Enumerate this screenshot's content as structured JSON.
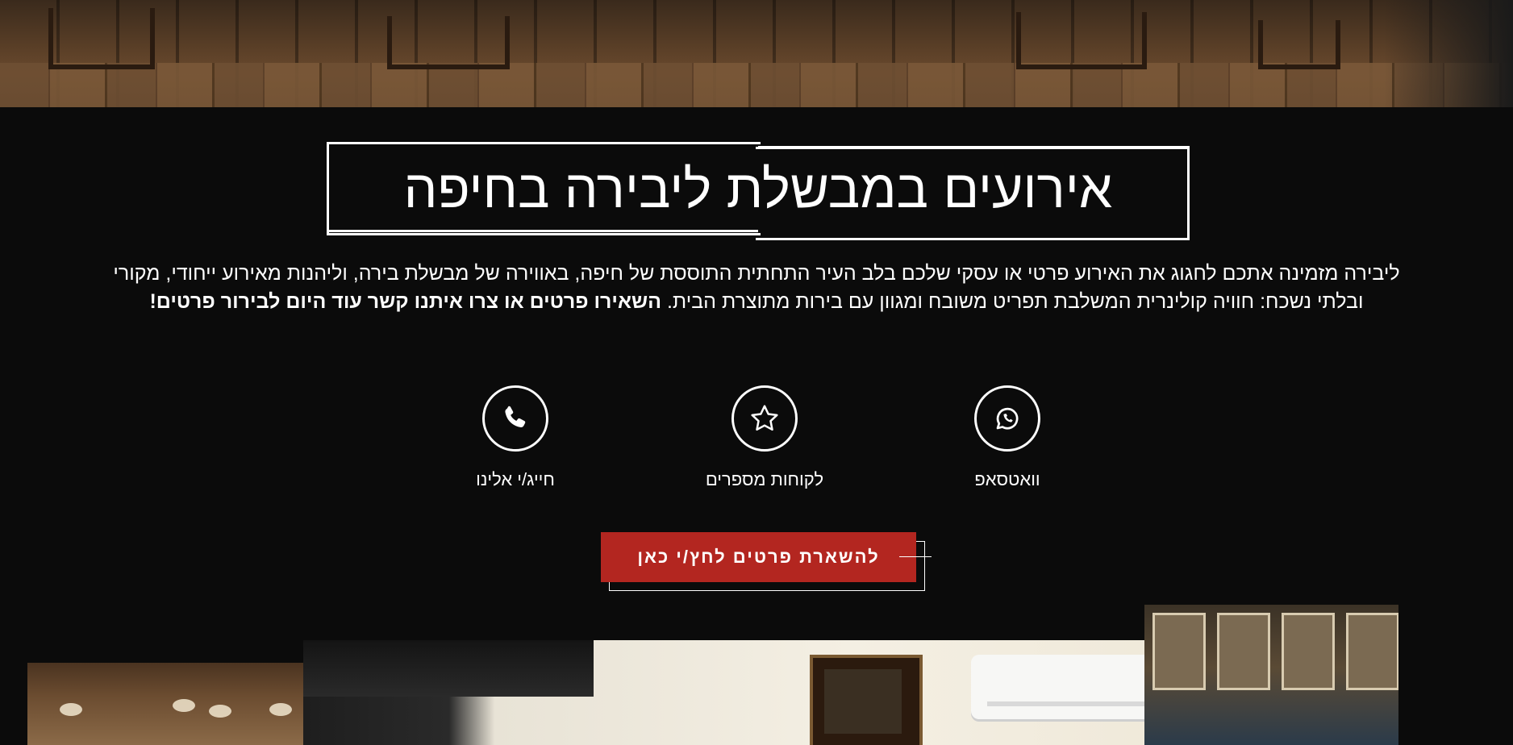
{
  "hero": {
    "image_name": "restaurant-interior-photo"
  },
  "title": "אירועים במבשלת ליבירה בחיפה",
  "intro": {
    "text": "ליבירה מזמינה אתכם לחגוג את האירוע פרטי או עסקי שלכם בלב העיר התחתית התוססת של חיפה, באווירה של מבשלת בירה, וליהנות מאירוע ייחודי, מקורי ובלתי נשכח: חוויה קולינרית המשלבת תפריט משובח ומגוון עם בירות מתוצרת הבית.",
    "bold": "השאירו פרטים או צרו איתנו קשר עוד היום לבירור פרטים!"
  },
  "features": [
    {
      "label": "וואטסאפ",
      "icon": "whatsapp-icon"
    },
    {
      "label": "לקוחות מספרים",
      "icon": "star-icon"
    },
    {
      "label": "חייג/י אלינו",
      "icon": "phone-icon"
    }
  ],
  "cta": {
    "label": "להשארת פרטים לחץ/י כאן",
    "color": "#b32620"
  },
  "colors": {
    "background": "#0b0b0b",
    "text": "#ffffff",
    "accent": "#b32620"
  }
}
